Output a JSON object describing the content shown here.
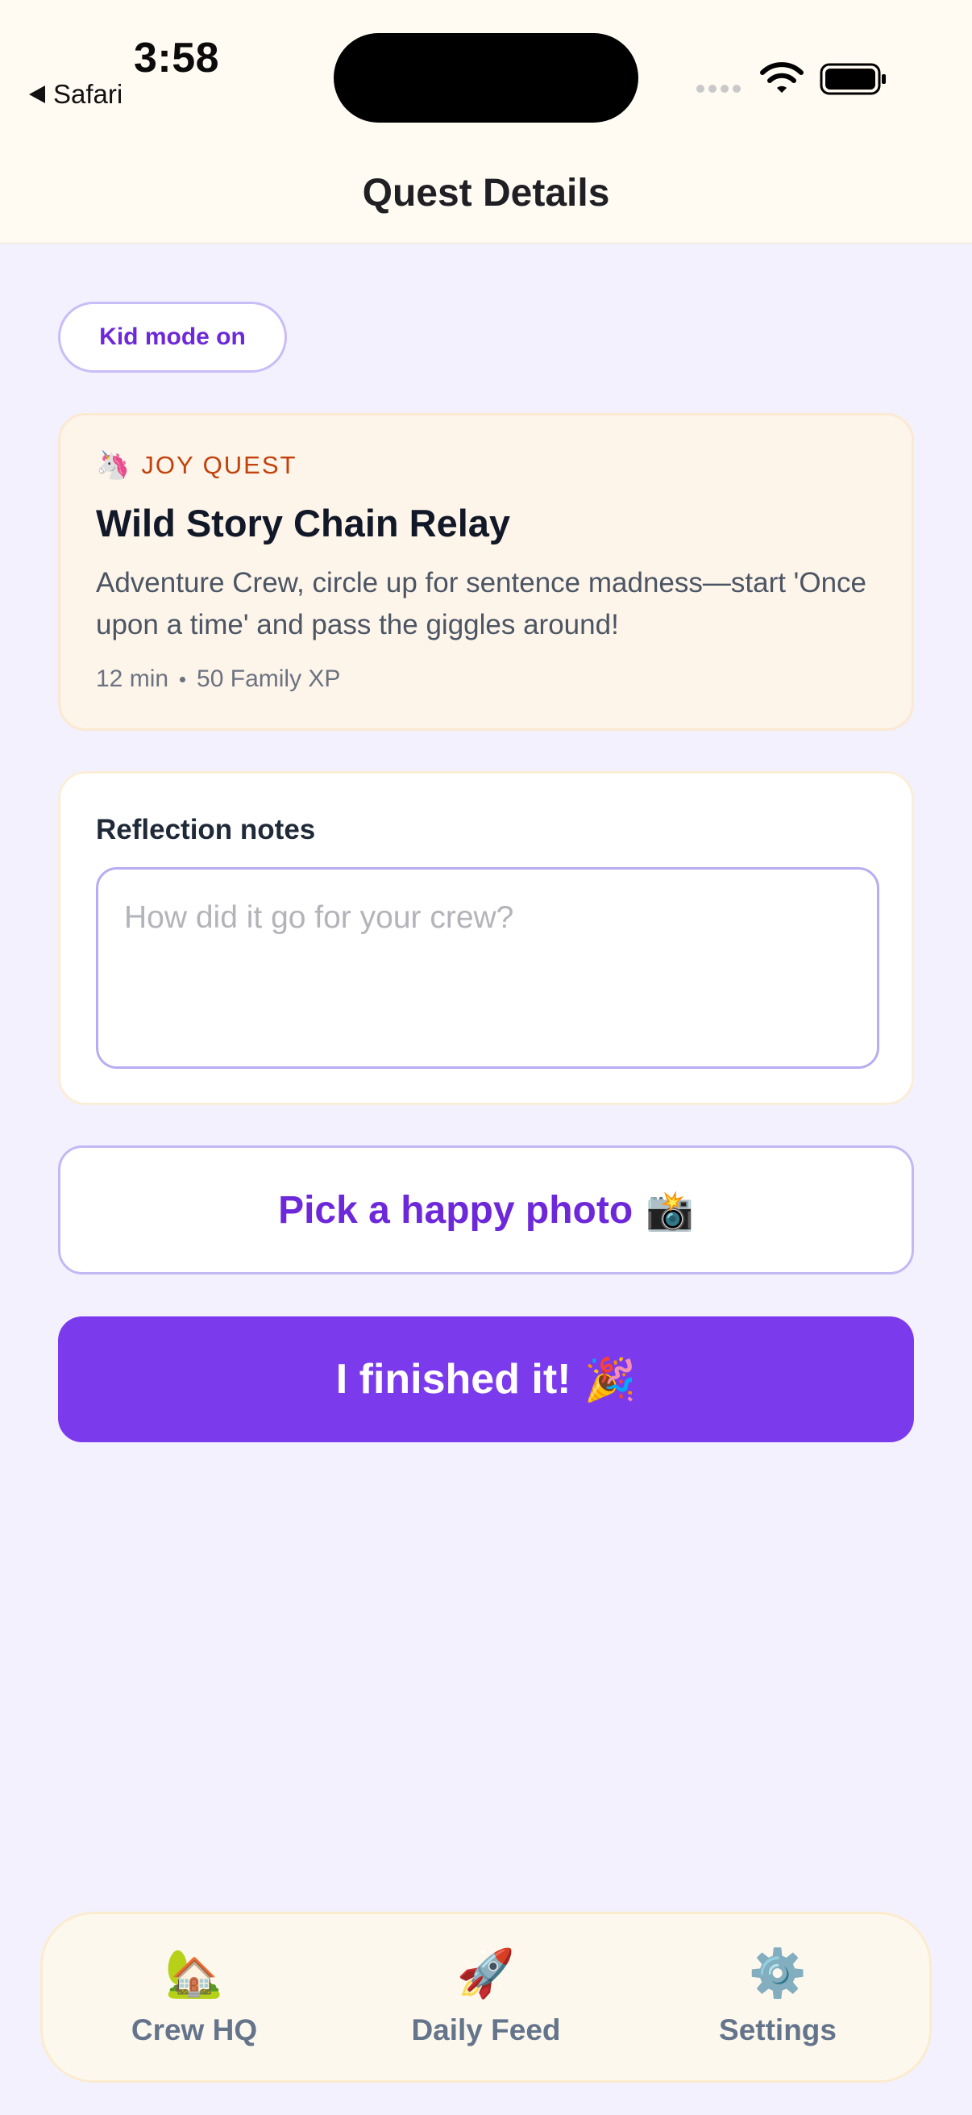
{
  "status_bar": {
    "time": "3:58",
    "back_label": "Safari"
  },
  "header": {
    "title": "Quest Details"
  },
  "kid_mode": {
    "label": "Kid mode on"
  },
  "quest": {
    "icon": "unicorn-icon",
    "category": "JOY QUEST",
    "title": "Wild Story Chain Relay",
    "description": "Adventure Crew, circle up for sentence madness—start 'Once upon a time' and pass the giggles around!",
    "duration": "12 min",
    "xp": "50 Family XP"
  },
  "reflection": {
    "label": "Reflection notes",
    "value": "",
    "placeholder": "How did it go for your crew?"
  },
  "actions": {
    "photo_label": "Pick a happy photo",
    "photo_icon": "camera-flash-icon",
    "finish_label": "I finished it!",
    "finish_icon": "party-popper-icon"
  },
  "tabs": [
    {
      "label": "Crew HQ",
      "icon": "house-tree-icon"
    },
    {
      "label": "Daily Feed",
      "icon": "rocket-icon"
    },
    {
      "label": "Settings",
      "icon": "gear-icon"
    }
  ],
  "colors": {
    "accent": "#7c3aed",
    "accent_text": "#6d28d9",
    "category": "#c2410c",
    "background": "#f4f1fe",
    "header_bg": "#fffaf2"
  }
}
